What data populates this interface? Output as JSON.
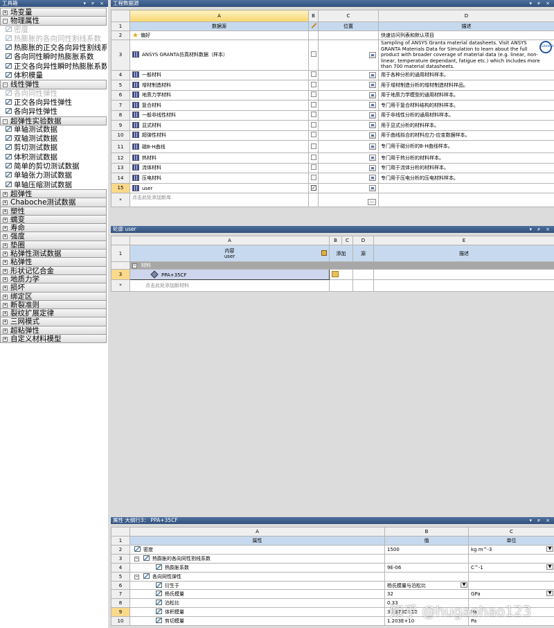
{
  "toolbox": {
    "title": "工具箱",
    "window_controls": "▾ ᴘ ×",
    "items": [
      {
        "kind": "cat",
        "sign": "+",
        "label": "场变量"
      },
      {
        "kind": "cat",
        "sign": "-",
        "label": "物理属性"
      },
      {
        "kind": "item",
        "disabled": true,
        "label": "密度"
      },
      {
        "kind": "item",
        "disabled": true,
        "label": "热膨胀的各向同性割线系数"
      },
      {
        "kind": "item",
        "disabled": false,
        "label": "热膨胀的正交各向异性割线系数"
      },
      {
        "kind": "item",
        "disabled": false,
        "label": "各向同性瞬时热膨胀系数"
      },
      {
        "kind": "item",
        "disabled": false,
        "label": "正交各向异性瞬时热膨胀系数"
      },
      {
        "kind": "item",
        "disabled": false,
        "label": "体积模量"
      },
      {
        "kind": "cat",
        "sign": "-",
        "label": "线性弹性"
      },
      {
        "kind": "item",
        "disabled": true,
        "label": "各向同性弹性"
      },
      {
        "kind": "item",
        "disabled": false,
        "label": "正交各向异性弹性"
      },
      {
        "kind": "item",
        "disabled": false,
        "label": "各向异性弹性"
      },
      {
        "kind": "cat",
        "sign": "-",
        "label": "超弹性实验数据"
      },
      {
        "kind": "item",
        "disabled": false,
        "label": "单轴测试数据"
      },
      {
        "kind": "item",
        "disabled": false,
        "label": "双轴测试数据"
      },
      {
        "kind": "item",
        "disabled": false,
        "label": "剪切测试数据"
      },
      {
        "kind": "item",
        "disabled": false,
        "label": "体积测试数据"
      },
      {
        "kind": "item",
        "disabled": false,
        "label": "简单的剪切测试数据"
      },
      {
        "kind": "item",
        "disabled": false,
        "label": "单轴张力测试数据"
      },
      {
        "kind": "item",
        "disabled": false,
        "label": "单轴压缩测试数据"
      },
      {
        "kind": "cat",
        "sign": "+",
        "label": "超弹性"
      },
      {
        "kind": "cat",
        "sign": "+",
        "label": "Chaboche测试数据"
      },
      {
        "kind": "cat",
        "sign": "+",
        "label": "塑性"
      },
      {
        "kind": "cat",
        "sign": "+",
        "label": "蠕变"
      },
      {
        "kind": "cat",
        "sign": "+",
        "label": "寿命"
      },
      {
        "kind": "cat",
        "sign": "+",
        "label": "强度"
      },
      {
        "kind": "cat",
        "sign": "+",
        "label": "垫圈"
      },
      {
        "kind": "cat",
        "sign": "+",
        "label": "粘弹性测试数据"
      },
      {
        "kind": "cat",
        "sign": "+",
        "label": "粘弹性"
      },
      {
        "kind": "cat",
        "sign": "+",
        "label": "形状记忆合金"
      },
      {
        "kind": "cat",
        "sign": "+",
        "label": "地质力学"
      },
      {
        "kind": "cat",
        "sign": "+",
        "label": "损坏"
      },
      {
        "kind": "cat",
        "sign": "+",
        "label": "绑定区"
      },
      {
        "kind": "cat",
        "sign": "+",
        "label": "断裂准则"
      },
      {
        "kind": "cat",
        "sign": "+",
        "label": "裂纹扩展定律"
      },
      {
        "kind": "cat",
        "sign": "+",
        "label": "三网模式"
      },
      {
        "kind": "cat",
        "sign": "+",
        "label": "超粘弹性"
      },
      {
        "kind": "cat",
        "sign": "+",
        "label": "自定义材料模型"
      }
    ]
  },
  "data_sources": {
    "title": "工程数据源",
    "window_controls": "▾ ᴘ ×",
    "col_letters": [
      "A",
      "B",
      "C",
      "D"
    ],
    "headers": {
      "a": "数据源",
      "b": "",
      "c": "位置",
      "d": "描述"
    },
    "rows": [
      {
        "n": "2",
        "name": "偏好",
        "icon": "star",
        "check": "none",
        "c_btn": false,
        "desc": "快速访问列表和默认项目"
      },
      {
        "n": "3",
        "name": "ANSYS GRANTA仿真材料数据（样本）",
        "icon": "lib",
        "check": "off",
        "c_btn": true,
        "desc": "Sampling of ANSYS Granta material datasheets. Visit ANSYS GRANTA Materials Data for Simulation to learn about the full product with broader coverage of material data (e.g. linear, non-linear, temperature dependant, fatigue etc.) which includes more than 700 material datasheets.",
        "logo": "GRANTA"
      },
      {
        "n": "4",
        "name": "一般材料",
        "icon": "lib",
        "check": "off",
        "c_btn": true,
        "desc": "用于各种分析的通用材料样本。"
      },
      {
        "n": "5",
        "name": "增材制造材料",
        "icon": "lib",
        "check": "off",
        "c_btn": true,
        "desc": "用于增材制造分析的增材制造材料样品。"
      },
      {
        "n": "6",
        "name": "地质力学材料",
        "icon": "lib",
        "check": "off",
        "c_btn": true,
        "desc": "用于地质力学模型的通用材料样本。"
      },
      {
        "n": "7",
        "name": "复合材料",
        "icon": "lib",
        "check": "off",
        "c_btn": true,
        "desc": "专门用于复合材料结构的材料样本。"
      },
      {
        "n": "8",
        "name": "一般非线性材料",
        "icon": "lib",
        "check": "off",
        "c_btn": true,
        "desc": "用于非线性分析的通用材料样本。"
      },
      {
        "n": "9",
        "name": "显式材料",
        "icon": "lib",
        "check": "off",
        "c_btn": true,
        "desc": "用于显式分析的材料样本。"
      },
      {
        "n": "10",
        "name": "超弹性材料",
        "icon": "lib",
        "check": "off",
        "c_btn": true,
        "desc": "用于曲线拟合的材料应力-应变数据样本。"
      },
      {
        "n": "11",
        "name": "磁B-H曲线",
        "icon": "lib",
        "check": "off",
        "c_btn": true,
        "desc": "专门用于磁分析的B-H曲线样本。"
      },
      {
        "n": "12",
        "name": "热材料",
        "icon": "lib",
        "check": "off",
        "c_btn": true,
        "desc": "专门用于热分析的材料样本。"
      },
      {
        "n": "13",
        "name": "流体材料",
        "icon": "lib",
        "check": "off",
        "c_btn": true,
        "desc": "专门用于流体分析的材料样本。"
      },
      {
        "n": "14",
        "name": "压电材料",
        "icon": "lib",
        "check": "off",
        "c_btn": true,
        "desc": "专门用于压电分析的压电材料样本。"
      },
      {
        "n": "15",
        "name": "user",
        "icon": "lib",
        "check": "on",
        "c_btn": true,
        "desc": ""
      }
    ],
    "add_row_hint": "点击此处添加新库",
    "new_row_marker": "*",
    "ellipsis": "..."
  },
  "outline": {
    "title": "轮廓 user",
    "window_controls": "▾ ᴘ ×",
    "col_letters": [
      "A",
      "B",
      "C",
      "D",
      "E"
    ],
    "headers": {
      "a_line1": "内容",
      "a_line2": "user",
      "b": "添加",
      "d": "源",
      "e": "描述"
    },
    "group_label": "材料",
    "material": "PPA+35CF",
    "add_hint": "点击此处添加新材料",
    "new_row_marker": "*"
  },
  "properties": {
    "title": "属性 大纲行3： PPA+35CF",
    "window_controls": "▾ ᴘ ×",
    "col_letters": [
      "A",
      "B",
      "C"
    ],
    "headers": {
      "a": "属性",
      "b": "值",
      "c": "单位"
    },
    "rows": [
      {
        "n": "2",
        "indent": 0,
        "sign": "",
        "label": "密度",
        "value": "1500",
        "unit": "kg m^-3",
        "unit_dd": true,
        "value_dd": false
      },
      {
        "n": "3",
        "indent": 0,
        "sign": "−",
        "label": "热膨胀的各向同性割线系数",
        "value": "",
        "unit": "",
        "unit_dd": false,
        "value_dd": false
      },
      {
        "n": "4",
        "indent": 1,
        "sign": "",
        "label": "热膨胀系数",
        "value": "9E-06",
        "unit": "C^-1",
        "unit_dd": true,
        "value_dd": false
      },
      {
        "n": "5",
        "indent": 0,
        "sign": "−",
        "label": "各向同性弹性",
        "value": "",
        "unit": "",
        "unit_dd": false,
        "value_dd": false
      },
      {
        "n": "6",
        "indent": 1,
        "sign": "",
        "label": "衍生于",
        "value": "杨氏模量与泊松比",
        "unit": "",
        "unit_dd": false,
        "value_dd": true
      },
      {
        "n": "7",
        "indent": 1,
        "sign": "",
        "label": "杨氏模量",
        "value": "32",
        "unit": "GPa",
        "unit_dd": true,
        "value_dd": false
      },
      {
        "n": "8",
        "indent": 1,
        "sign": "",
        "label": "泊松比",
        "value": "0.33",
        "unit": "",
        "unit_dd": false,
        "value_dd": false
      },
      {
        "n": "9",
        "indent": 1,
        "sign": "",
        "label": "体积模量",
        "value": "3.1373E+10",
        "unit": "Pa",
        "unit_dd": false,
        "value_dd": false,
        "selected": true
      },
      {
        "n": "10",
        "indent": 1,
        "sign": "",
        "label": "剪切模量",
        "value": "1.203E+10",
        "unit": "Pa",
        "unit_dd": false,
        "value_dd": false
      }
    ]
  },
  "watermark": "知乎 @hugaohao123"
}
